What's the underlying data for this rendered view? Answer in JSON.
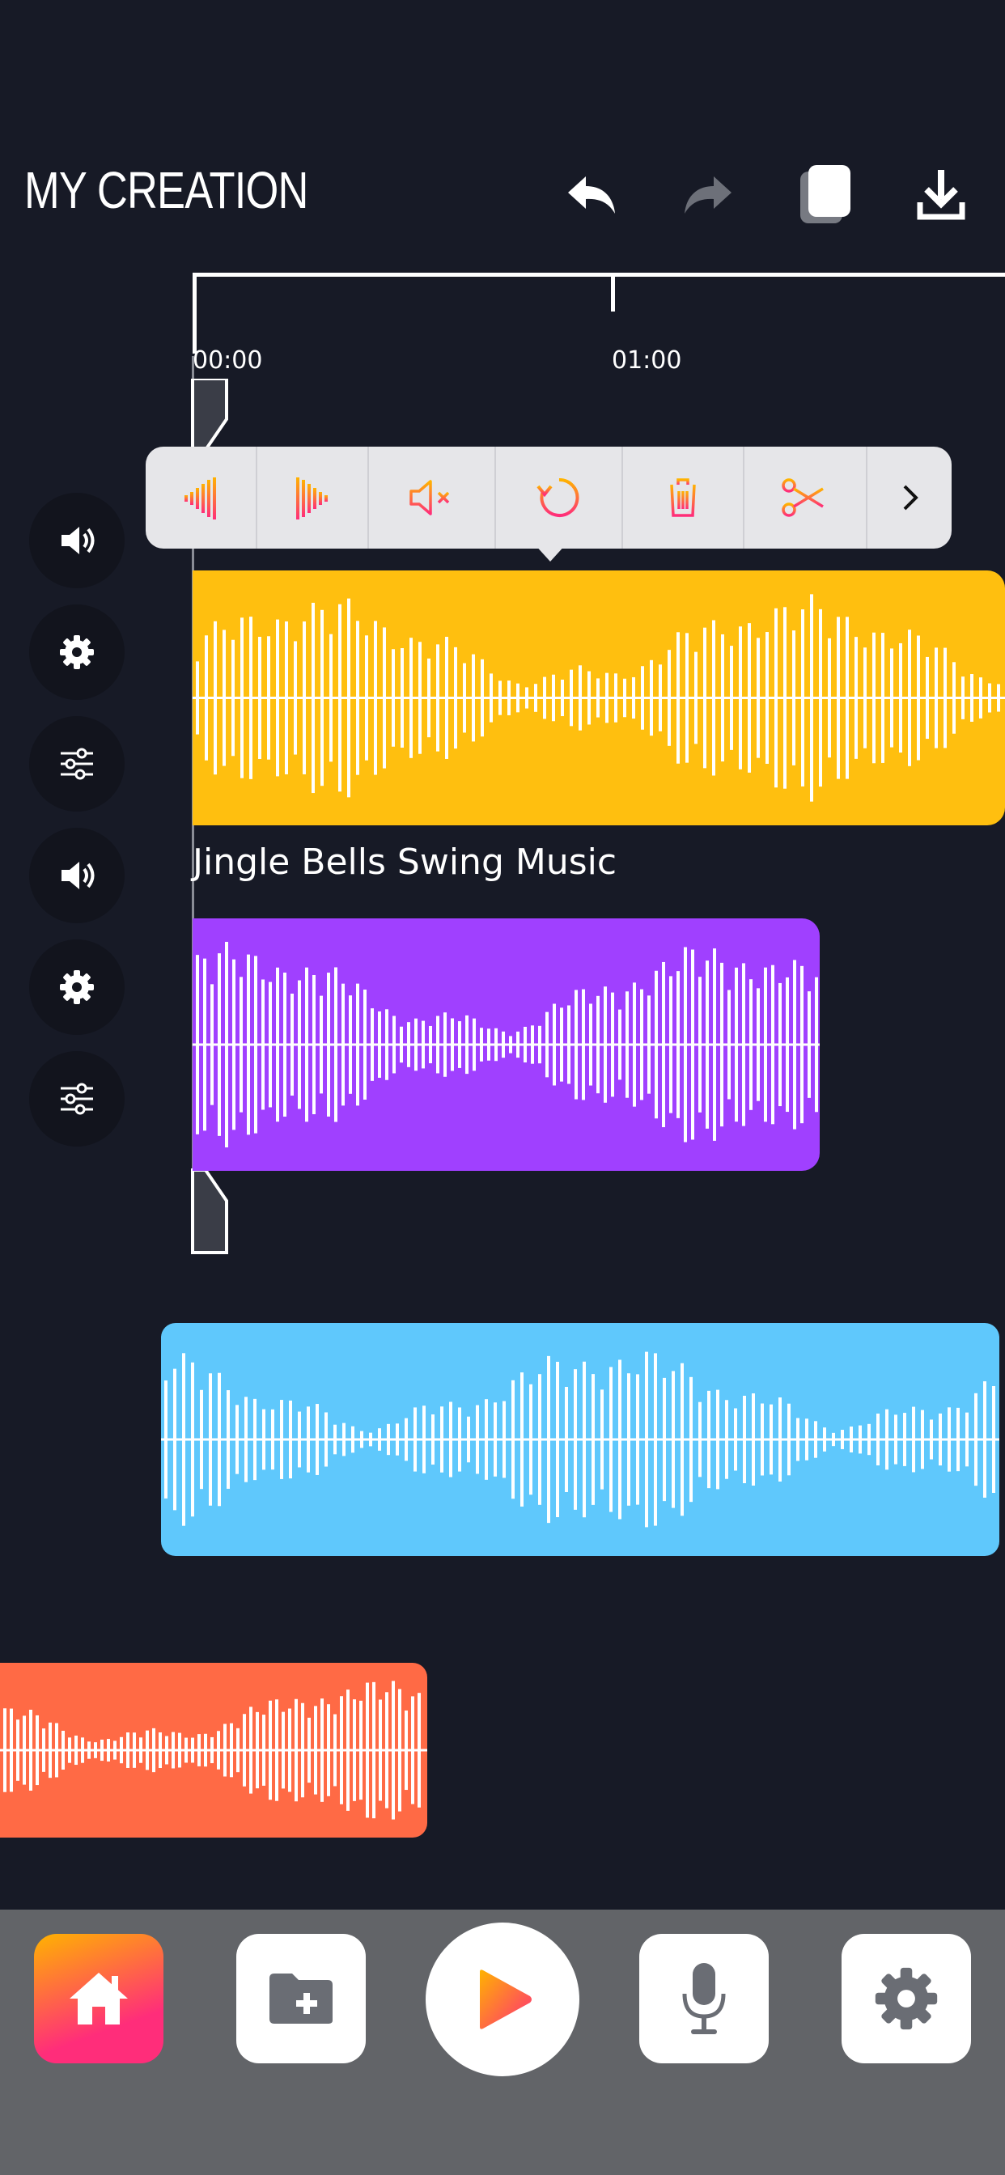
{
  "header": {
    "title": "MY CREATION",
    "undo_icon": "undo-icon",
    "redo_icon": "redo-icon",
    "copy_icon": "copy-icon",
    "download_icon": "download-icon"
  },
  "timeline": {
    "ticks": [
      "00:00",
      "01:00"
    ]
  },
  "popup_toolbar": {
    "items": [
      {
        "icon": "fade-in-icon"
      },
      {
        "icon": "fade-out-icon"
      },
      {
        "icon": "mute-icon"
      },
      {
        "icon": "loop-icon"
      },
      {
        "icon": "trash-icon"
      },
      {
        "icon": "scissors-icon"
      },
      {
        "icon": "chevron-right-icon"
      }
    ]
  },
  "tracks": [
    {
      "name": "",
      "color": "#ffbf0f"
    },
    {
      "name": "Jingle Bells Swing Music",
      "color": "#a040ff"
    },
    {
      "name": "",
      "color": "#5fc8fc"
    },
    {
      "name": "",
      "color": "#ff6a45"
    }
  ],
  "side_controls": [
    "volume-icon",
    "gear-icon",
    "sliders-icon",
    "volume-icon",
    "gear-icon",
    "sliders-icon"
  ],
  "bottom_nav": {
    "items": [
      "home-icon",
      "add-folder-icon",
      "play-icon",
      "microphone-icon",
      "gear-icon"
    ],
    "accent": "#ff2d7a"
  }
}
